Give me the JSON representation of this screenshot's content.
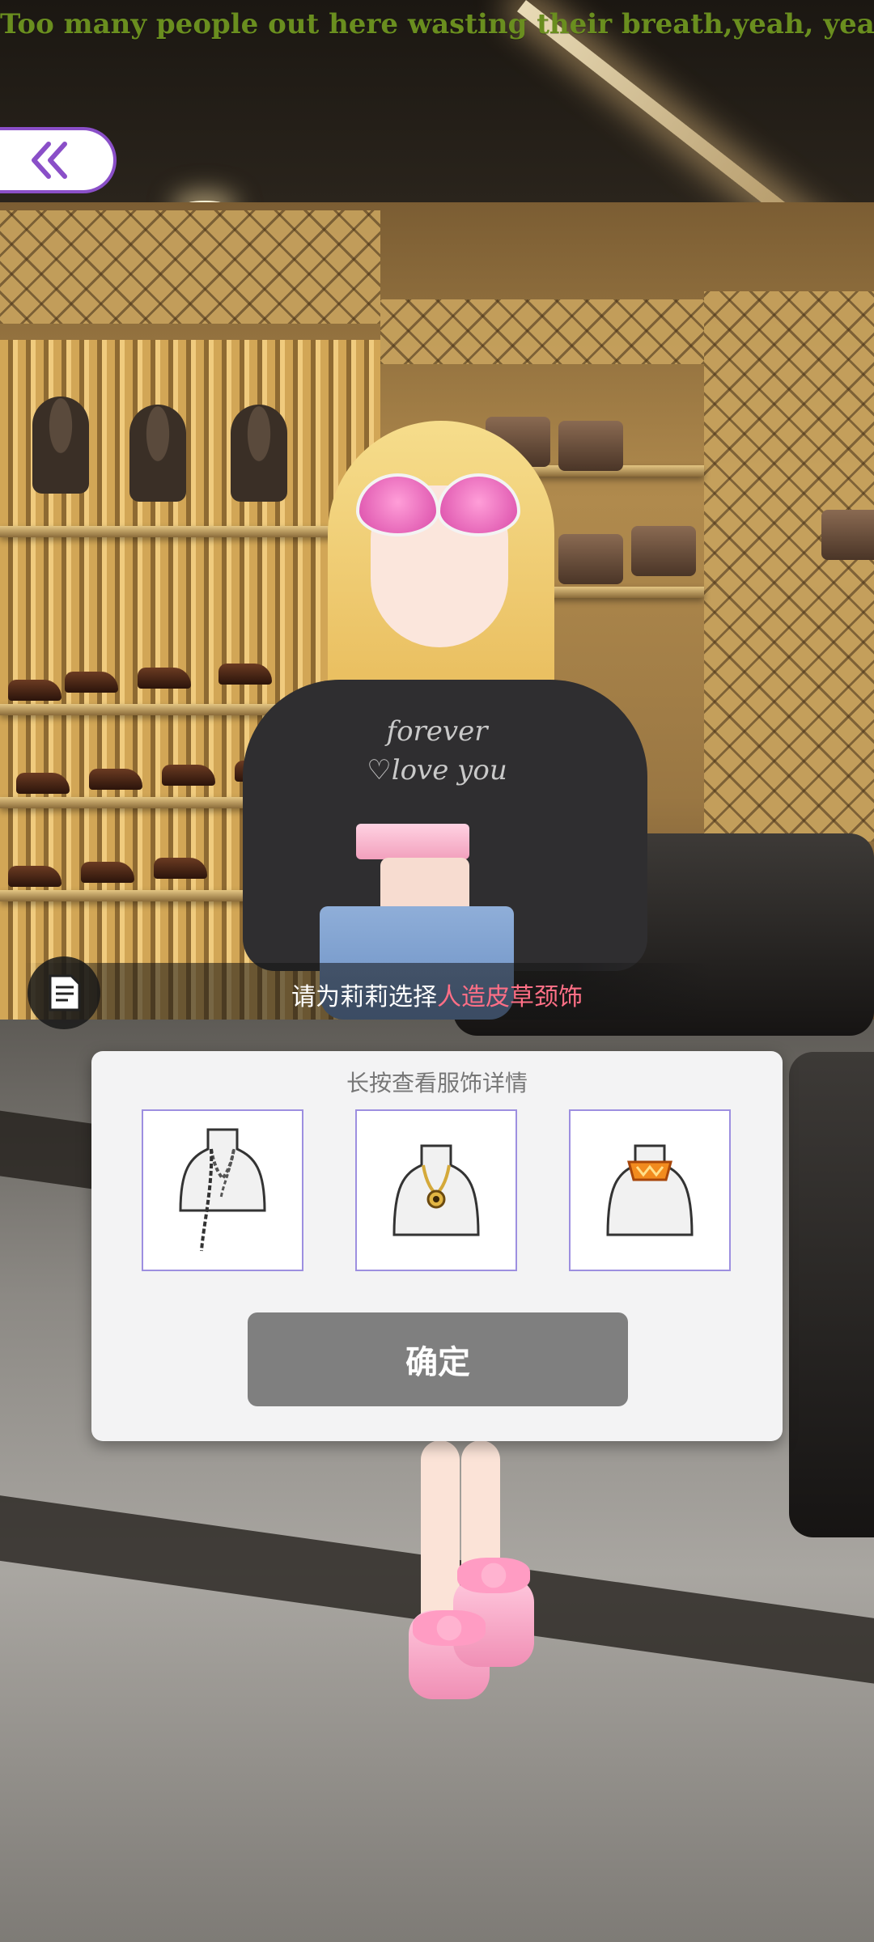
{
  "marquee": {
    "text": "Too many people out here wasting their breath,yeah, yeah"
  },
  "dialog": {
    "prefix": "请为莉莉选择",
    "highlight": "人造皮草颈饰"
  },
  "panel": {
    "hint": "长按查看服饰详情",
    "confirm_label": "确定",
    "items": [
      {
        "icon": "chain-necklace-icon"
      },
      {
        "icon": "gold-pendant-necklace-icon"
      },
      {
        "icon": "orange-collar-necklace-icon"
      }
    ]
  },
  "colors": {
    "marquee": "#6a8e1f",
    "accent_purple": "#8a4fc8",
    "highlight_pink": "#ff6f86",
    "confirm_gray": "#7f7f7f",
    "card_border": "#9d8fe0"
  }
}
